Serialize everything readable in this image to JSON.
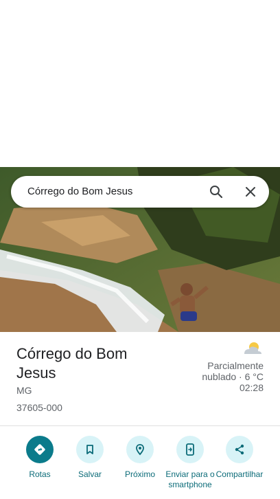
{
  "search": {
    "query": "Córrego do Bom Jesus"
  },
  "place": {
    "title": "Córrego do Bom Jesus",
    "region": "MG",
    "postal_code": "37605-000"
  },
  "weather": {
    "icon": "partly-cloudy-icon",
    "line1": "Parcialmente",
    "line2": "nublado · 6 °C",
    "time": "02:28"
  },
  "actions": [
    {
      "label": "Rotas",
      "icon": "directions-icon"
    },
    {
      "label": "Salvar",
      "icon": "bookmark-icon"
    },
    {
      "label": "Próximo",
      "icon": "nearby-icon"
    },
    {
      "label": "Enviar para o smartphone",
      "icon": "send-to-phone-icon"
    },
    {
      "label": "Compartilhar",
      "icon": "share-icon"
    }
  ],
  "colors": {
    "accent": "#0b7b8b",
    "accent_light": "#d8f3f7"
  }
}
